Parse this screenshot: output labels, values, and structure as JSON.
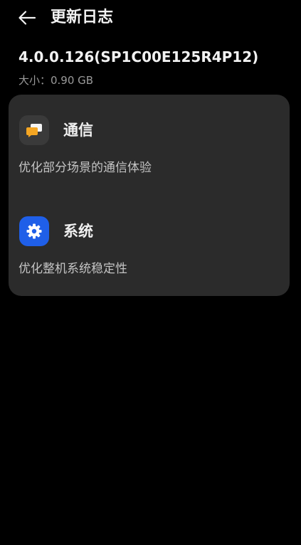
{
  "header": {
    "back_icon": "arrow-left-icon",
    "title": "更新日志"
  },
  "update": {
    "version": "4.0.0.126(SP1C00E125R4P12)",
    "size_text": "大小：0.90 GB"
  },
  "changelog": {
    "sections": [
      {
        "icon": "messaging-icon",
        "title": "通信",
        "description": "优化部分场景的通信体验"
      },
      {
        "icon": "settings-gear-icon",
        "title": "系统",
        "description": "优化整机系统稳定性"
      }
    ]
  },
  "colors": {
    "background": "#000000",
    "card": "#2b2b2b",
    "system_icon_bg": "#1f5fe8",
    "message_icon_orange": "#f5a623",
    "secondary_text": "#9a9a9a"
  }
}
